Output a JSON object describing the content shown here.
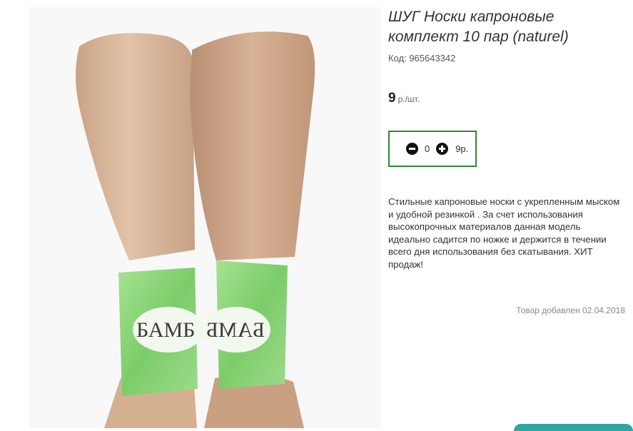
{
  "product": {
    "title": "ШУГ Носки капроновые комплект 10 пар (naturel)",
    "sku": "Код: 965643342",
    "price_amount": "9",
    "price_unit": "р./шт.",
    "quantity": "0",
    "total": "9р.",
    "description": "Стильные капроновые носки с укрепленным мыском и удобной резинкой . За счет использования высокопрочных материалов данная модель идеально садится по ножке и держится в течении всего дня использования без скатывания. ХИТ продаж!",
    "added_date": "Товар добавлен 02.04.2018",
    "image_band_text": "БАМБ",
    "image_band_text_right": "БАМБ"
  },
  "colors": {
    "qty_border": "#2e8b2e",
    "sock_left": "#d9b79a",
    "sock_right": "#cfa98a",
    "band_green": "#8fd47e"
  },
  "icons": {
    "minus": "minus-circle-icon",
    "plus": "plus-circle-icon"
  }
}
